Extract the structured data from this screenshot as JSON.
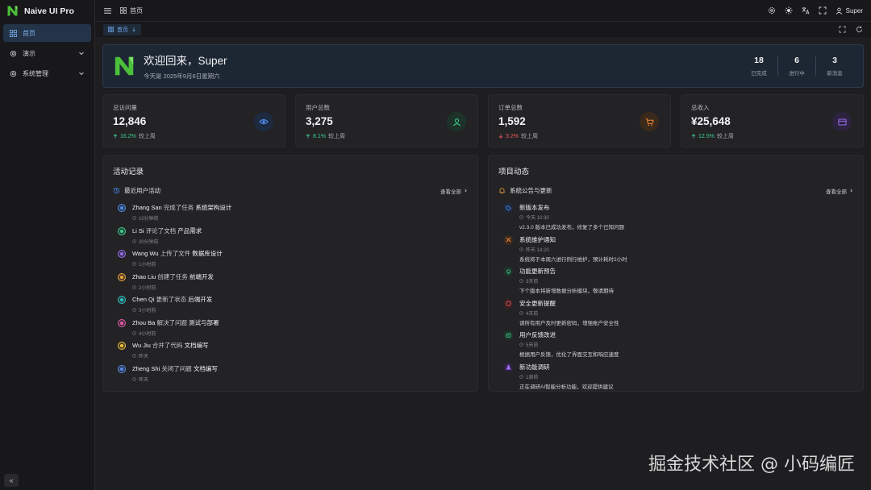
{
  "app": {
    "name": "Naive UI Pro"
  },
  "sidebar": {
    "items": [
      {
        "label": "首页",
        "icon": "dashboard-icon",
        "active": true
      },
      {
        "label": "演示",
        "icon": "gear-icon",
        "expandable": true
      },
      {
        "label": "系统管理",
        "icon": "gear-icon",
        "expandable": true
      }
    ],
    "collapse_label": "«"
  },
  "header": {
    "breadcrumb": "首页",
    "user": "Super"
  },
  "tabs": [
    {
      "label": "首页"
    }
  ],
  "welcome": {
    "title": "欢迎回来，Super",
    "subtitle": "今天是 2025年9月6日星期六",
    "stats": [
      {
        "value": "18",
        "label": "已完成"
      },
      {
        "value": "6",
        "label": "进行中"
      },
      {
        "value": "3",
        "label": "新消息"
      }
    ]
  },
  "cards": [
    {
      "title": "总访问量",
      "value": "12,846",
      "trend": "16.2%",
      "direction": "up",
      "suffix": "较上周",
      "icon": "eye-icon",
      "color": "#4d8ef0",
      "bg": "#1d2a40"
    },
    {
      "title": "用户总数",
      "value": "3,275",
      "trend": "8.1%",
      "direction": "up",
      "suffix": "较上周",
      "icon": "user-icon",
      "color": "#3ecf8e",
      "bg": "#1d3329"
    },
    {
      "title": "订单总数",
      "value": "1,592",
      "trend": "3.2%",
      "direction": "down",
      "suffix": "较上周",
      "icon": "cart-icon",
      "color": "#f0883a",
      "bg": "#3a2a1c"
    },
    {
      "title": "总收入",
      "value": "¥25,648",
      "trend": "12.5%",
      "direction": "up",
      "suffix": "较上周",
      "icon": "card-icon",
      "color": "#9b6cf0",
      "bg": "#2d2340"
    }
  ],
  "activity": {
    "title": "活动记录",
    "subtitle": "最近用户活动",
    "more": "查看全部",
    "items": [
      {
        "user": "Zhang San",
        "action": "完成了任务",
        "target": "系统架构设计",
        "time": "10分钟前",
        "color": "#4d8ef0"
      },
      {
        "user": "Li Si",
        "action": "评论了文档",
        "target": "产品需求",
        "time": "30分钟前",
        "color": "#3ecf8e"
      },
      {
        "user": "Wang Wu",
        "action": "上传了文件",
        "target": "数据库设计",
        "time": "1小时前",
        "color": "#9b6cf0"
      },
      {
        "user": "Zhao Liu",
        "action": "创建了任务",
        "target": "前端开发",
        "time": "2小时前",
        "color": "#f0a53a"
      },
      {
        "user": "Chen Qi",
        "action": "更新了状态",
        "target": "后端开发",
        "time": "3小时前",
        "color": "#2ec4c4"
      },
      {
        "user": "Zhou Ba",
        "action": "解决了问题",
        "target": "测试与部署",
        "time": "4小时前",
        "color": "#e85aa8"
      },
      {
        "user": "Wu Jiu",
        "action": "合并了代码",
        "target": "文档编写",
        "time": "昨天",
        "color": "#f0c23a"
      },
      {
        "user": "Zheng Shi",
        "action": "关闭了问题",
        "target": "文档编写",
        "time": "昨天",
        "color": "#5a8cf0"
      }
    ]
  },
  "project": {
    "title": "项目动态",
    "subtitle": "系统公告与更新",
    "more": "查看全部",
    "items": [
      {
        "title": "新版本发布",
        "time": "今天 10:30",
        "desc": "v2.3.0 版本已成功发布，修复了多个已知问题",
        "icon": "tag-icon",
        "color": "#4d8ef0",
        "bg": "#1d2a40"
      },
      {
        "title": "系统维护通知",
        "time": "昨天 14:20",
        "desc": "系统将于本周六进行例行维护，预计耗时2小时",
        "icon": "tools-icon",
        "color": "#f0883a",
        "bg": "#3a2a1c"
      },
      {
        "title": "功能更新预告",
        "time": "3天前",
        "desc": "下个版本将新增数据分析模块，敬请期待",
        "icon": "bulb-icon",
        "color": "#3ecf8e",
        "bg": "#1d3329"
      },
      {
        "title": "安全更新提醒",
        "time": "4天前",
        "desc": "请所有用户及时更新密码，增强账户安全性",
        "icon": "shield-icon",
        "color": "#f0595a",
        "bg": "#3a1f22"
      },
      {
        "title": "用户反馈改进",
        "time": "5天前",
        "desc": "根据用户反馈，优化了界面交互和响应速度",
        "icon": "chat-icon",
        "color": "#3ecf8e",
        "bg": "#1d3329"
      },
      {
        "title": "新功能调研",
        "time": "1周前",
        "desc": "正在调研AI智能分析功能，欢迎提供建议",
        "icon": "flask-icon",
        "color": "#9b6cf0",
        "bg": "#2d2340"
      }
    ]
  },
  "watermark": "掘金技术社区 @ 小码编匠"
}
